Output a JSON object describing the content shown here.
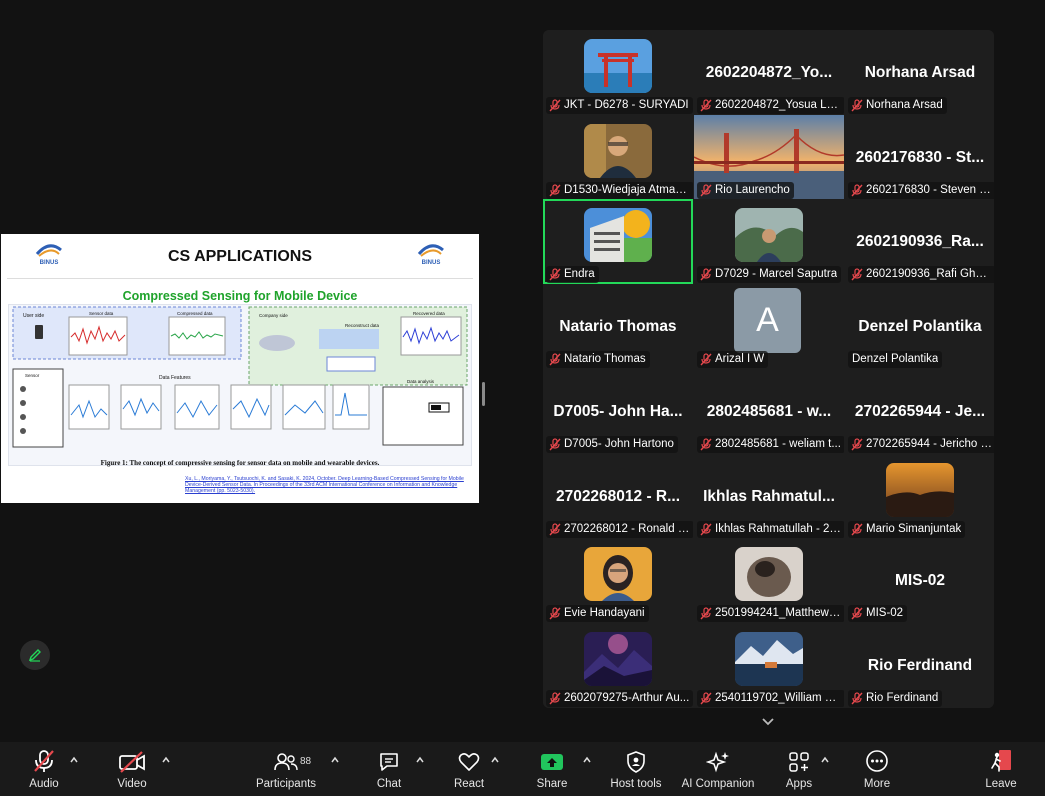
{
  "slide": {
    "title": "CS APPLICATIONS",
    "subtitle": "Compressed Sensing for Mobile Device",
    "caption": "Figure 1: The concept of compressive sensing for sensor data on mobile and wearable devices.",
    "reference": "Xu, L., Moriyama, Y., Tsutsuochi, K. and Sasaki, K. 2024, October. Deep Learning-Based Compressed Sensing for Mobile Device-Derived Sensor Data. In Proceedings of the 33rd ACM International Conference on Information and Knowledge Management (pp. 5023-5030).",
    "logo_left": "BINUS UNIVERSITY",
    "logo_right": "BINUS HIGHER EDUCATION",
    "fig_labels": {
      "user_side": "User side",
      "sensor": "Sensor",
      "sensor_data": "Sensor data",
      "compressed_data": "Compressed data",
      "company_side": "Company side",
      "recovered_data": "Recovered data",
      "data_features": "Data Features",
      "upload": "Upload data",
      "reconstruct": "Reconstruct data",
      "analysis": "Data analysis"
    }
  },
  "tiles": [
    {
      "label": "JKT - D6278 - SURYADI",
      "big": "",
      "type": "thumb",
      "img": "shrine"
    },
    {
      "label": "2602204872_Yosua Lum...",
      "big": "2602204872_Yo...",
      "type": "name"
    },
    {
      "label": "Norhana Arsad",
      "big": "Norhana Arsad",
      "type": "name"
    },
    {
      "label": "D1530-Wiedjaja Atmadja",
      "big": "",
      "type": "thumb",
      "img": "person1"
    },
    {
      "label": "Rio Laurencho",
      "big": "",
      "type": "full",
      "img": "bridge"
    },
    {
      "label": "2602176830 - Steven Lawr...",
      "big": "2602176830 - St...",
      "type": "name"
    },
    {
      "label": "Endra",
      "big": "",
      "type": "thumb",
      "img": "building",
      "active": true
    },
    {
      "label": "D7029 - Marcel Saputra",
      "big": "",
      "type": "thumb",
      "img": "person2"
    },
    {
      "label": "2602190936_Rafi Ghazi B",
      "big": "2602190936_Ra...",
      "type": "name"
    },
    {
      "label": "Natario Thomas",
      "big": "Natario Thomas",
      "type": "name"
    },
    {
      "label": "Arizal I W",
      "big": "A",
      "type": "letter"
    },
    {
      "label": "Denzel Polantika",
      "big": "Denzel Polantika",
      "type": "name",
      "nomic": true
    },
    {
      "label": "D7005- John Hartono",
      "big": "D7005- John Ha...",
      "type": "name"
    },
    {
      "label": "2802485681 - weliam t...",
      "big": "2802485681 - w...",
      "type": "name"
    },
    {
      "label": "2702265944 - Jericho J...",
      "big": "2702265944 - Je...",
      "type": "name"
    },
    {
      "label": "2702268012 - Ronald C...",
      "big": "2702268012 - R...",
      "type": "name"
    },
    {
      "label": "Ikhlas Rahmatullah - 27...",
      "big": "Ikhlas Rahmatul...",
      "type": "name"
    },
    {
      "label": "Mario Simanjuntak",
      "big": "",
      "type": "thumb",
      "img": "sunset"
    },
    {
      "label": "Evie Handayani",
      "big": "",
      "type": "thumb",
      "img": "person3"
    },
    {
      "label": "2501994241_Matthew F...",
      "big": "",
      "type": "thumb",
      "img": "blur"
    },
    {
      "label": "MIS-02",
      "big": "MIS-02",
      "type": "name"
    },
    {
      "label": "2602079275-Arthur Au...",
      "big": "",
      "type": "thumb",
      "img": "mountain"
    },
    {
      "label": "2540119702_William deli",
      "big": "",
      "type": "thumb",
      "img": "lake"
    },
    {
      "label": "Rio Ferdinand",
      "big": "Rio Ferdinand",
      "type": "name"
    }
  ],
  "toolbar": {
    "audio": "Audio",
    "video": "Video",
    "participants": "Participants",
    "participants_count": "88",
    "chat": "Chat",
    "react": "React",
    "share": "Share",
    "host_tools": "Host tools",
    "ai_companion": "AI Companion",
    "apps": "Apps",
    "more": "More",
    "leave": "Leave"
  },
  "colors": {
    "active_border": "#23d959",
    "muted_red": "#e5484d",
    "share_green": "#21c55d",
    "slide_subtitle": "#1fa32b"
  }
}
